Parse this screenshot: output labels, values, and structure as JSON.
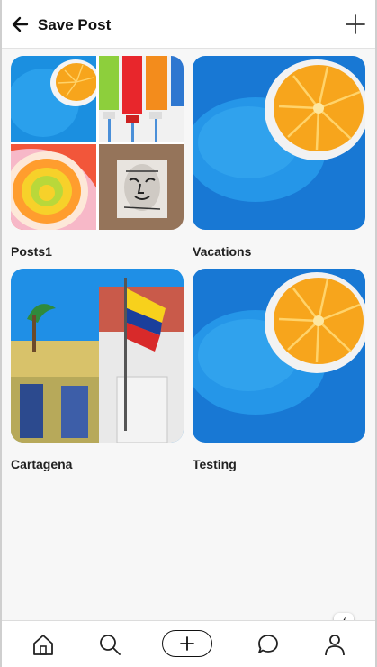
{
  "header": {
    "title": "Save Post",
    "back_icon": "arrow-left-icon",
    "add_icon": "plus-icon"
  },
  "boards": [
    {
      "label": "Posts1",
      "cover": "collage"
    },
    {
      "label": "Vacations",
      "cover": "blue-orange"
    },
    {
      "label": "Cartagena",
      "cover": "colorful-street"
    },
    {
      "label": "Testing",
      "cover": "blue-orange"
    }
  ],
  "bottom_nav": {
    "items": [
      "home-icon",
      "search-icon",
      "create-plus-icon",
      "messages-icon",
      "profile-icon"
    ],
    "badge_icon": "lightning-bolt-icon"
  },
  "colors": {
    "accent_blue": "#1b8fe0",
    "orange": "#f7a51c",
    "background": "#f7f7f7"
  }
}
